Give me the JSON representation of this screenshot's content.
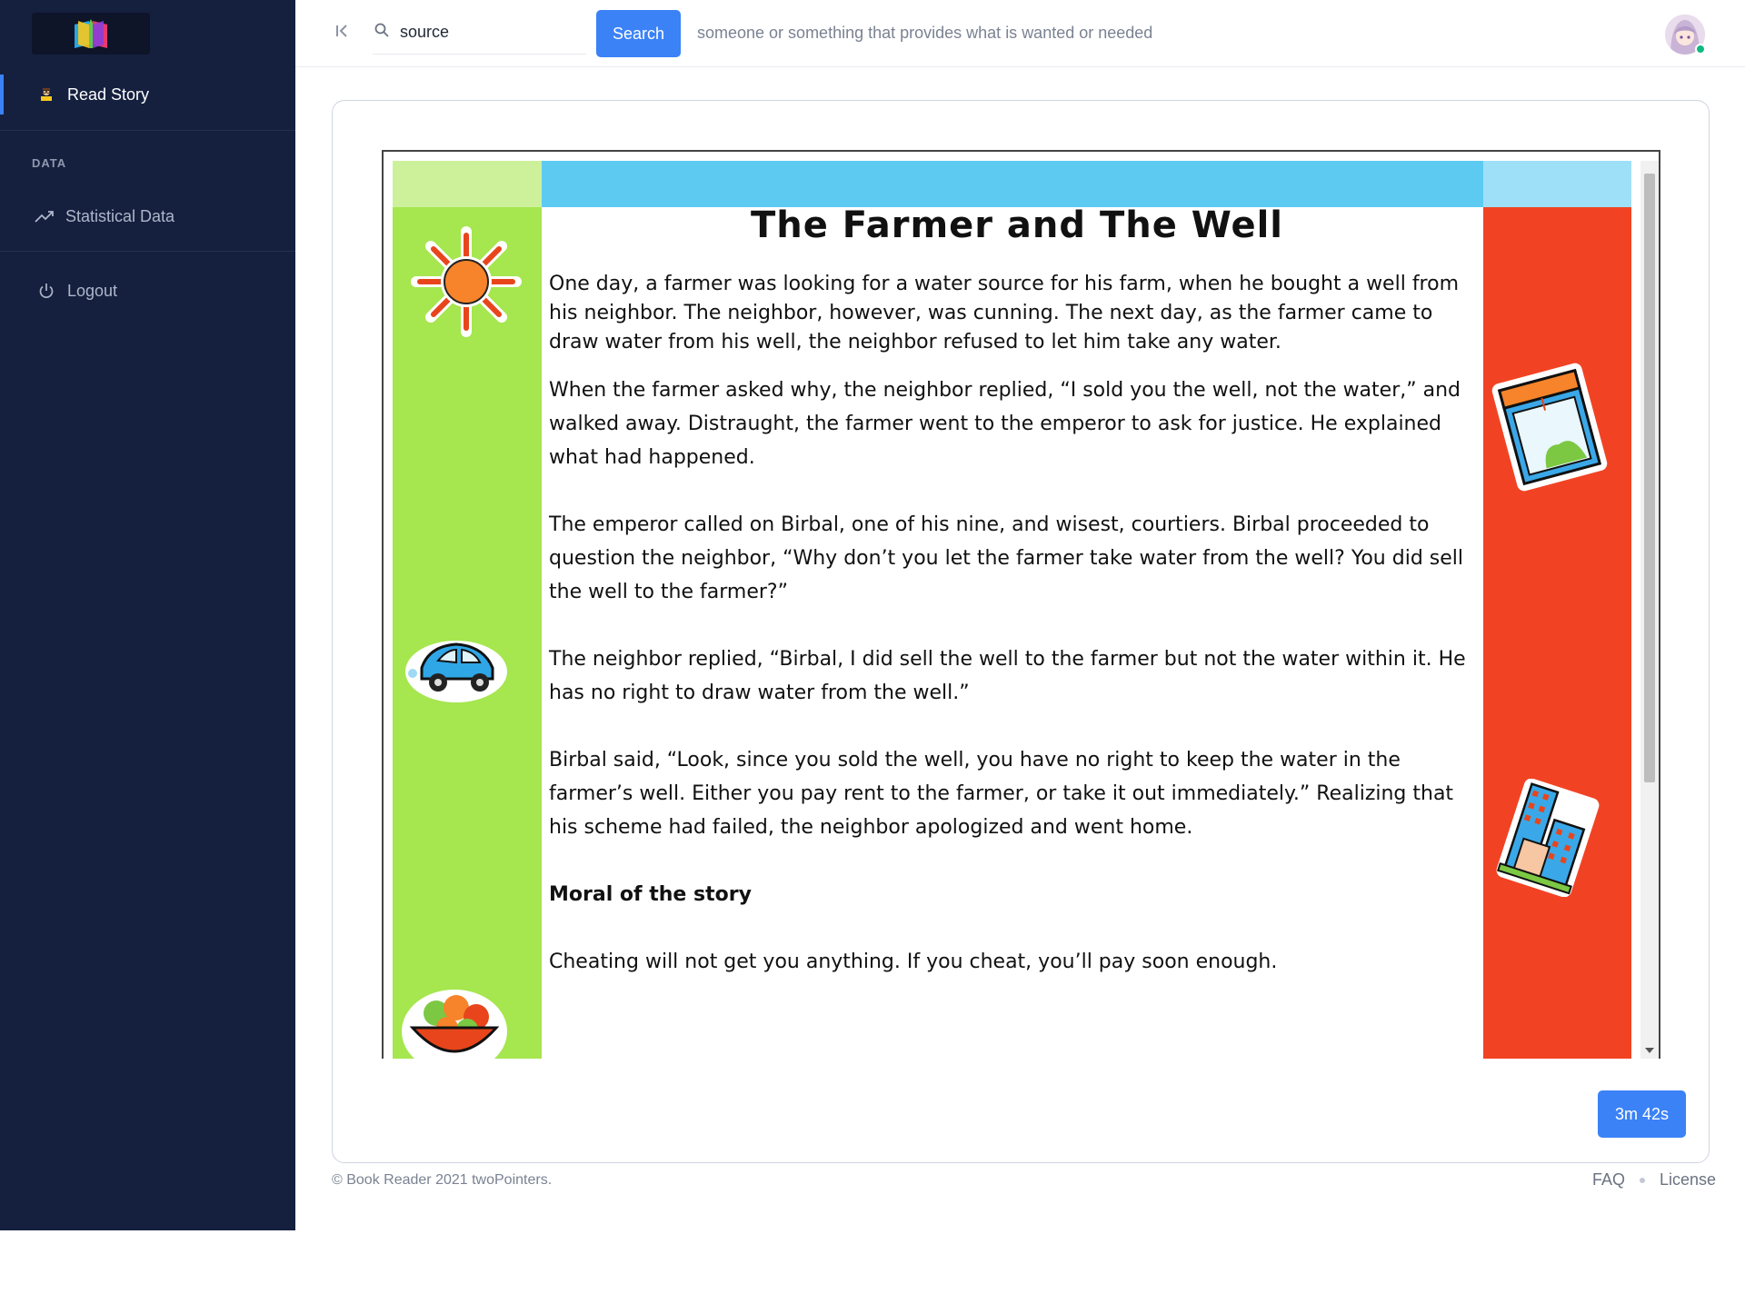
{
  "sidebar": {
    "read_story": "Read Story",
    "section_label": "DATA",
    "statistical_data": "Statistical Data",
    "logout": "Logout"
  },
  "topbar": {
    "search_value": "source",
    "search_button": "Search",
    "definition": "someone or something that provides what is wanted or needed"
  },
  "story": {
    "title": "The Farmer and The Well",
    "paragraphs": [
      "One day, a farmer was looking for a water source for his farm, when he bought a well from his neighbor. The neighbor, however, was cunning. The next day, as the farmer came to draw water from his well, the neighbor refused to let him take any water.",
      "When the farmer asked why, the neighbor replied, “I sold you the well, not the water,” and walked away. Distraught, the farmer went to the emperor to ask for justice. He explained what had happened.",
      "The emperor called on Birbal, one of his nine, and wisest, courtiers. Birbal proceeded to question the neighbor, “Why don’t you let the farmer take water from the well? You did sell the well to the farmer?”",
      "The neighbor replied, “Birbal, I did sell the well to the farmer but not the water within it. He has no right to draw water from the well.”",
      "Birbal said, “Look, since you sold the well, you have no right to keep the water in the farmer’s well. Either you pay rent to the farmer, or take it out immediately.” Realizing that his scheme had failed, the neighbor apologized and went home."
    ],
    "moral_heading": "Moral of the story",
    "moral": "Cheating will not get you anything. If you cheat, you’ll pay soon enough."
  },
  "timer": "3m 42s",
  "footer": {
    "copyright": "© Book Reader 2021 twoPointers.",
    "faq": "FAQ",
    "license": "License"
  },
  "colors": {
    "sidebar_bg": "#15203f",
    "accent": "#3b82f6",
    "left_column": "#a6e64f",
    "right_column": "#f14324",
    "header_band": "#5dcbf1"
  },
  "icons": [
    "book-logo-icon",
    "reader-icon",
    "trending-up-icon",
    "power-icon",
    "collapse-icon",
    "search-icon",
    "sun-sticker",
    "car-sticker",
    "fruit-bowl-sticker",
    "window-picture-sticker",
    "building-sticker"
  ]
}
